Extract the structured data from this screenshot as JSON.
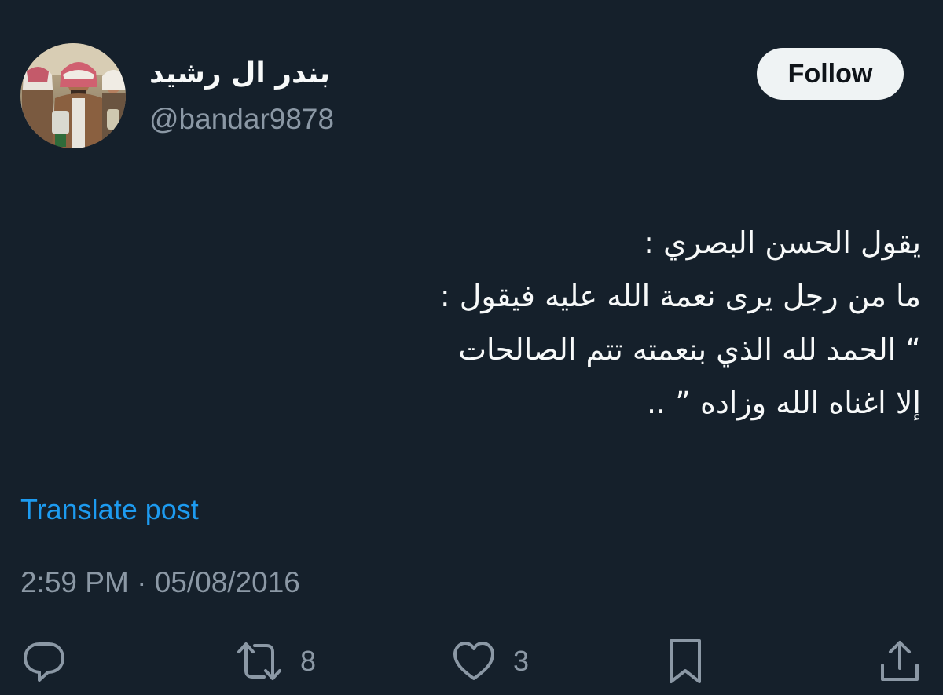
{
  "author": {
    "display_name": "بندر ال رشيد",
    "handle": "@bandar9878",
    "avatar_icon": "profile-photo"
  },
  "follow_button": {
    "label": "Follow"
  },
  "post": {
    "lines": [
      "يقول الحسن البصري :",
      "ما من رجل يرى نعمة الله عليه فيقول :",
      "“ الحمد لله الذي بنعمته تتم الصالحات",
      "إلا اغناه الله وزاده ” .."
    ],
    "translate_label": "Translate post",
    "time": "2:59 PM",
    "separator": "·",
    "date": "05/08/2016"
  },
  "actions": {
    "reply": {
      "icon": "reply-icon"
    },
    "repost": {
      "icon": "repost-icon",
      "count": "8"
    },
    "like": {
      "icon": "heart-icon",
      "count": "3"
    },
    "bookmark": {
      "icon": "bookmark-icon"
    },
    "share": {
      "icon": "share-icon"
    }
  },
  "colors": {
    "background": "#15202b",
    "text": "#f7f9f9",
    "secondary_text": "#8b98a5",
    "link": "#1d9bf0",
    "follow_bg": "#eff3f4"
  }
}
